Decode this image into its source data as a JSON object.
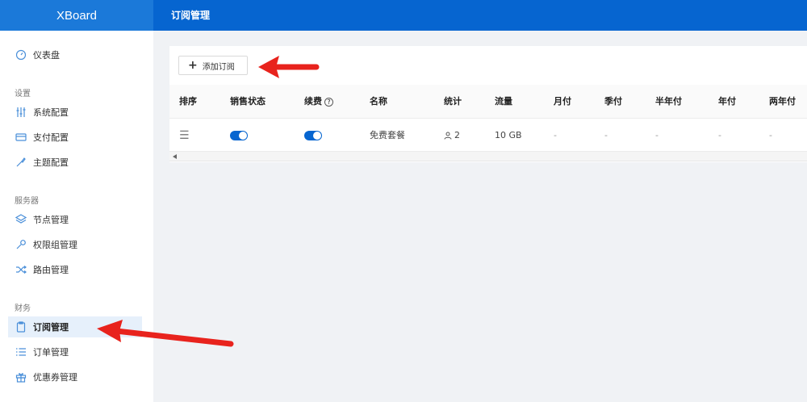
{
  "app": {
    "brand": "XBoard",
    "page_title": "订阅管理"
  },
  "sidebar": {
    "dashboard": "仪表盘",
    "sections": {
      "settings": "设置",
      "server": "服务器",
      "finance": "财务"
    },
    "items": {
      "system_config": "系统配置",
      "payment_config": "支付配置",
      "theme_config": "主题配置",
      "node_management": "节点管理",
      "permission_group": "权限组管理",
      "route_management": "路由管理",
      "subscription_management": "订阅管理",
      "order_management": "订单管理",
      "coupon_management": "优惠券管理"
    },
    "active_item": "订阅管理"
  },
  "toolbar": {
    "add_label": "添加订阅"
  },
  "table": {
    "headers": {
      "sort": "排序",
      "sale_status": "销售状态",
      "renew": "续费",
      "name": "名称",
      "stats": "统计",
      "traffic": "流量",
      "monthly": "月付",
      "quarterly": "季付",
      "half_year": "半年付",
      "yearly": "年付",
      "two_year": "两年付"
    },
    "rows": [
      {
        "sale_enabled": true,
        "renew_enabled": true,
        "name": "免费套餐",
        "stats": "2",
        "traffic": "10 GB",
        "monthly": "-",
        "quarterly": "-",
        "half_year": "-",
        "yearly": "-",
        "two_year": "-"
      }
    ]
  },
  "colors": {
    "primary": "#0665d0",
    "brand_bg": "#1b79d9",
    "annotation_arrow": "#e8231d"
  }
}
